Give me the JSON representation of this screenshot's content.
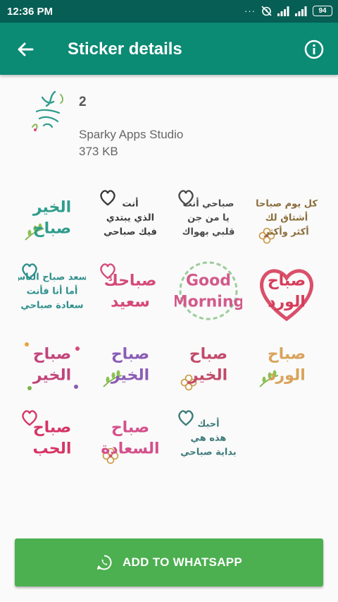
{
  "status_bar": {
    "time": "12:36 PM",
    "overflow": "···",
    "battery": "94"
  },
  "app_bar": {
    "title": "Sticker details",
    "back_icon": "arrow-back-icon",
    "info_icon": "info-icon"
  },
  "pack": {
    "name": "2",
    "publisher": "Sparky Apps Studio",
    "size": "373 KB"
  },
  "stickers": [
    {
      "lines": [
        "الخير",
        "صباح"
      ],
      "color": "#2e9d8c",
      "deco": "sprig"
    },
    {
      "lines": [
        "أنت",
        "الذي يبتدي",
        "فيك صباحي"
      ],
      "color": "#3a3a3a",
      "deco": "heart"
    },
    {
      "lines": [
        "صباحي أنت",
        "يا من جن",
        "قلبي بهواك"
      ],
      "color": "#4a4a4a",
      "deco": "heart"
    },
    {
      "lines": [
        "كل يوم صباحا",
        "أشتاق لك",
        "أكثر وأكثر"
      ],
      "color": "#8a6d3b",
      "deco": "flower"
    },
    {
      "lines": [
        "يسعد صباح الناس",
        "أما أنا فأنت",
        "سعادة صباحي"
      ],
      "color": "#2e8f8a",
      "deco": "heart"
    },
    {
      "lines": [
        "صباحك",
        "سعيد"
      ],
      "color": "#d44a7a",
      "deco": "heart"
    },
    {
      "lines": [
        "Good",
        "Morning"
      ],
      "color": "#d25a8a",
      "deco": "wreath"
    },
    {
      "lines": [
        "صباح",
        "الورد"
      ],
      "color": "#d63c5a",
      "deco": "bigheart"
    },
    {
      "lines": [
        "صباح",
        "الخير"
      ],
      "color": "#c2447a",
      "deco": "dots"
    },
    {
      "lines": [
        "صباح",
        "الخير"
      ],
      "color": "#8b5cb5",
      "deco": "sprig"
    },
    {
      "lines": [
        "صباح",
        "الخير"
      ],
      "color": "#c24a6a",
      "deco": "flower"
    },
    {
      "lines": [
        "صباح",
        "الورد"
      ],
      "color": "#d9a35a",
      "deco": "sprig"
    },
    {
      "lines": [
        "صباح",
        "الحب"
      ],
      "color": "#d63465",
      "deco": "heart"
    },
    {
      "lines": [
        "صباح",
        "السعادة"
      ],
      "color": "#d4508a",
      "deco": "flower"
    },
    {
      "lines": [
        "أحبك",
        "هذه هي",
        "بداية صباحي"
      ],
      "color": "#3d7a7a",
      "deco": "heart"
    }
  ],
  "colors": {
    "status_bar": "#075e54",
    "app_bar": "#0b8a74",
    "button": "#4caf50"
  },
  "button": {
    "label": "ADD TO WHATSAPP",
    "icon": "whatsapp-icon"
  }
}
